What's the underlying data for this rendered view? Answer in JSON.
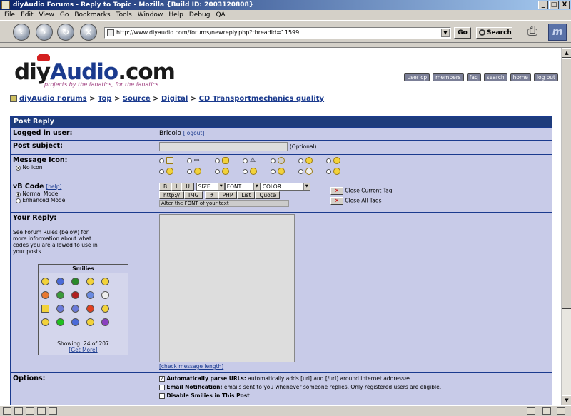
{
  "window": {
    "title": "diyAudio Forums - Reply to Topic - Mozilla {Build ID: 2003120808}",
    "controls": [
      "_",
      "□",
      "X"
    ]
  },
  "menu": [
    "File",
    "Edit",
    "View",
    "Go",
    "Bookmarks",
    "Tools",
    "Window",
    "Help",
    "Debug",
    "QA"
  ],
  "toolbar": {
    "url": "http://www.diyaudio.com/forums/newreply.php?threadid=11599",
    "go_label": "Go",
    "search_label": "Search"
  },
  "site": {
    "logo_part1": "diy",
    "logo_part2": "Audio",
    "logo_part3": ".com",
    "tagline": "projects by the fanatics, for the fanatics",
    "nav": [
      "user cp",
      "members",
      "faq",
      "search",
      "home",
      "log out"
    ]
  },
  "breadcrumb": {
    "items": [
      "diyAudio Forums",
      "Top",
      "Source",
      "Digital",
      "CD Transportmechanics quality"
    ],
    "sep": " > "
  },
  "form": {
    "title": "Post Reply",
    "logged_label": "Logged in user:",
    "username": "Bricolo",
    "logout": "[logout]",
    "subject_label": "Post subject:",
    "subject_hint": "(Optional)",
    "icon_label": "Message Icon:",
    "no_icon": "No icon",
    "vb_label": "vB Code",
    "vb_help": "[help]",
    "mode_normal": "Normal Mode",
    "mode_enhanced": "Enhanced Mode",
    "btn_b": "B",
    "btn_i": "I",
    "btn_u": "U",
    "sel_size": "SIZE",
    "sel_font": "FONT",
    "sel_color": "COLOR",
    "btn_http": "http://",
    "btn_img": "IMG",
    "btn_hash": "#",
    "btn_php": "PHP",
    "btn_list": "List",
    "btn_quote": "Quote",
    "helpline": "Alter the FONT of your text",
    "close_current": "Close Current Tag",
    "close_all": "Close All Tags",
    "reply_label": "Your Reply:",
    "reply_note": "See Forum Rules (below) for more information about what codes you are allowed to use in your posts.",
    "smilies_title": "Smilies",
    "smilies_showing": "Showing: 24 of 207",
    "smilies_more": "[Get More]",
    "check_length": "[check message length]",
    "options_label": "Options:",
    "opt1_bold": "Automatically parse URLs:",
    "opt1_text": " automatically adds [url] and [/url] around internet addresses.",
    "opt2_bold": "Email Notification:",
    "opt2_text": " emails sent to you whenever someone replies. Only registered users are eligible.",
    "opt3_bold": "Disable Smilies in This Post",
    "opt3_text": ""
  },
  "colors": {
    "header_blue": "#1e3c7c",
    "row_bg": "#c8cbe8",
    "logo_blue": "#1a3a8e"
  }
}
